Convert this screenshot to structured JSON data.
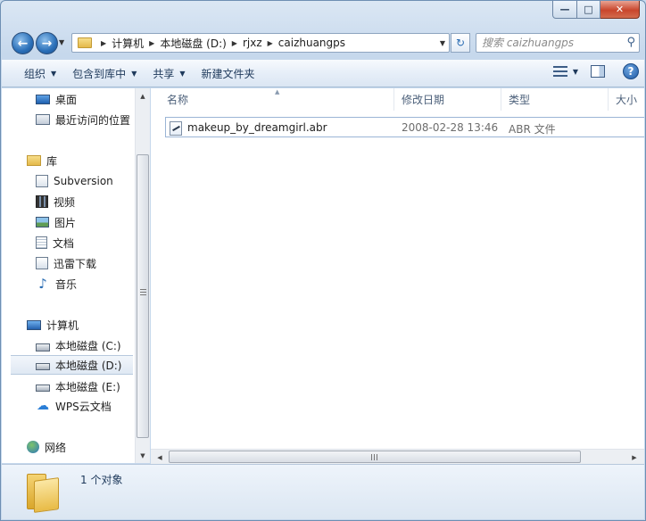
{
  "window": {
    "caption": {
      "minimize": "—",
      "maximize": "□",
      "close": "✕"
    }
  },
  "address": {
    "crumbs": [
      "计算机",
      "本地磁盘 (D:)",
      "rjxz",
      "caizhuangps"
    ]
  },
  "search": {
    "placeholder": "搜索 caizhuangps"
  },
  "toolbar": {
    "organize": "组织",
    "include_library": "包含到库中",
    "share": "共享",
    "new_folder": "新建文件夹"
  },
  "nav": {
    "favorites": [
      {
        "label": "桌面",
        "icon": "desktop-icon"
      },
      {
        "label": "最近访问的位置",
        "icon": "recent-places-icon"
      }
    ],
    "libraries_label": "库",
    "libraries": [
      {
        "label": "Subversion",
        "icon": "library-icon"
      },
      {
        "label": "视频",
        "icon": "video-icon"
      },
      {
        "label": "图片",
        "icon": "pictures-icon"
      },
      {
        "label": "文档",
        "icon": "documents-icon"
      },
      {
        "label": "迅雷下载",
        "icon": "download-icon"
      },
      {
        "label": "音乐",
        "icon": "music-icon"
      }
    ],
    "computer_label": "计算机",
    "drives": [
      {
        "label": "本地磁盘 (C:)",
        "icon": "system-drive-icon"
      },
      {
        "label": "本地磁盘 (D:)",
        "icon": "drive-icon",
        "selected": true
      },
      {
        "label": "本地磁盘 (E:)",
        "icon": "drive-icon"
      },
      {
        "label": "WPS云文档",
        "icon": "cloud-icon"
      }
    ],
    "network_label": "网络"
  },
  "columns": {
    "name": "名称",
    "modified": "修改日期",
    "type": "类型",
    "size": "大小"
  },
  "files": [
    {
      "name": "makeup_by_dreamgirl.abr",
      "modified": "2008-02-28 13:46",
      "type": "ABR 文件"
    }
  ],
  "status": {
    "count": "1 个对象"
  }
}
